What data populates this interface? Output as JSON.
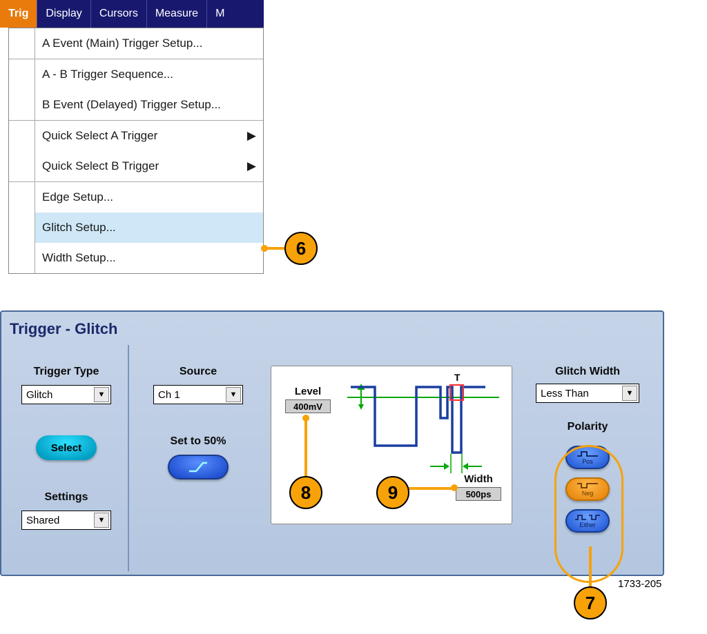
{
  "menubar": {
    "items": [
      "Trig",
      "Display",
      "Cursors",
      "Measure",
      "M"
    ]
  },
  "dropdown": {
    "items": [
      {
        "label": "A Event (Main) Trigger Setup..."
      },
      {
        "label": "A - B Trigger Sequence..."
      },
      {
        "label": "B Event (Delayed) Trigger Setup..."
      },
      {
        "label": "Quick Select A Trigger",
        "submenu": true
      },
      {
        "label": "Quick Select B Trigger",
        "submenu": true
      },
      {
        "label": "Edge Setup..."
      },
      {
        "label": "Glitch Setup...",
        "highlighted": true
      },
      {
        "label": "Width Setup..."
      }
    ]
  },
  "panel": {
    "title": "Trigger - Glitch",
    "triggerType": {
      "label": "Trigger Type",
      "value": "Glitch"
    },
    "select": {
      "label": "Select"
    },
    "settings": {
      "label": "Settings",
      "value": "Shared"
    },
    "source": {
      "label": "Source",
      "value": "Ch 1"
    },
    "setTo50": {
      "label": "Set to 50%"
    },
    "level": {
      "label": "Level",
      "value": "400mV"
    },
    "width": {
      "label": "Width",
      "value": "500ps"
    },
    "glitchWidth": {
      "label": "Glitch Width",
      "value": "Less Than"
    },
    "polarity": {
      "label": "Polarity",
      "pos": "Pos",
      "neg": "Neg",
      "either": "Either"
    },
    "timingLabel": "T"
  },
  "callouts": {
    "c6": "6",
    "c7": "7",
    "c8": "8",
    "c9": "9"
  },
  "docId": "1733-205"
}
